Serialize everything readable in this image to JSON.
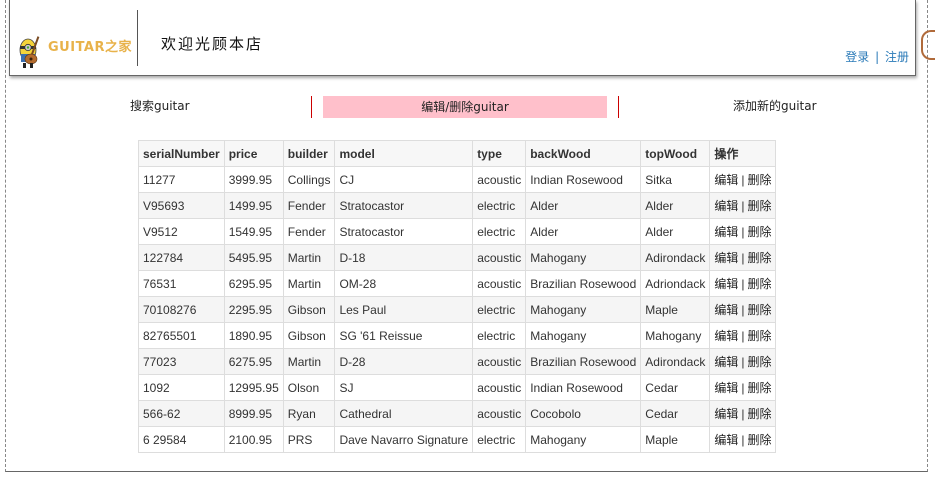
{
  "header": {
    "logo_text": "GUITAR之家",
    "welcome": "欢迎光顾本店",
    "login": "登录",
    "register": "注册",
    "separator": "|"
  },
  "nav": {
    "search": "搜索guitar",
    "edit_delete": "编辑/删除guitar",
    "add": "添加新的guitar",
    "active_bg": "#ffc0cb",
    "separator_color": "#cc0000"
  },
  "table": {
    "columns": [
      "serialNumber",
      "price",
      "builder",
      "model",
      "type",
      "backWood",
      "topWood",
      "操作"
    ],
    "edit_label": "编辑",
    "delete_label": "删除",
    "action_sep": "|",
    "rows": [
      [
        "11277",
        "3999.95",
        "Collings",
        "CJ",
        "acoustic",
        "Indian Rosewood",
        "Sitka"
      ],
      [
        "V95693",
        "1499.95",
        "Fender",
        "Stratocastor",
        "electric",
        "Alder",
        "Alder"
      ],
      [
        "V9512",
        "1549.95",
        "Fender",
        "Stratocastor",
        "electric",
        "Alder",
        "Alder"
      ],
      [
        "122784",
        "5495.95",
        "Martin",
        "D-18",
        "acoustic",
        "Mahogany",
        "Adirondack"
      ],
      [
        "76531",
        "6295.95",
        "Martin",
        "OM-28",
        "acoustic",
        "Brazilian Rosewood",
        "Adriondack"
      ],
      [
        "70108276",
        "2295.95",
        "Gibson",
        "Les Paul",
        "electric",
        "Mahogany",
        "Maple"
      ],
      [
        "82765501",
        "1890.95",
        "Gibson",
        "SG '61 Reissue",
        "electric",
        "Mahogany",
        "Mahogany"
      ],
      [
        "77023",
        "6275.95",
        "Martin",
        "D-28",
        "acoustic",
        "Brazilian Rosewood",
        "Adirondack"
      ],
      [
        "1092",
        "12995.95",
        "Olson",
        "SJ",
        "acoustic",
        "Indian Rosewood",
        "Cedar"
      ],
      [
        "566-62",
        "8999.95",
        "Ryan",
        "Cathedral",
        "acoustic",
        "Cocobolo",
        "Cedar"
      ],
      [
        "6 29584",
        "2100.95",
        "PRS",
        "Dave Navarro Signature",
        "electric",
        "Mahogany",
        "Maple"
      ]
    ]
  }
}
